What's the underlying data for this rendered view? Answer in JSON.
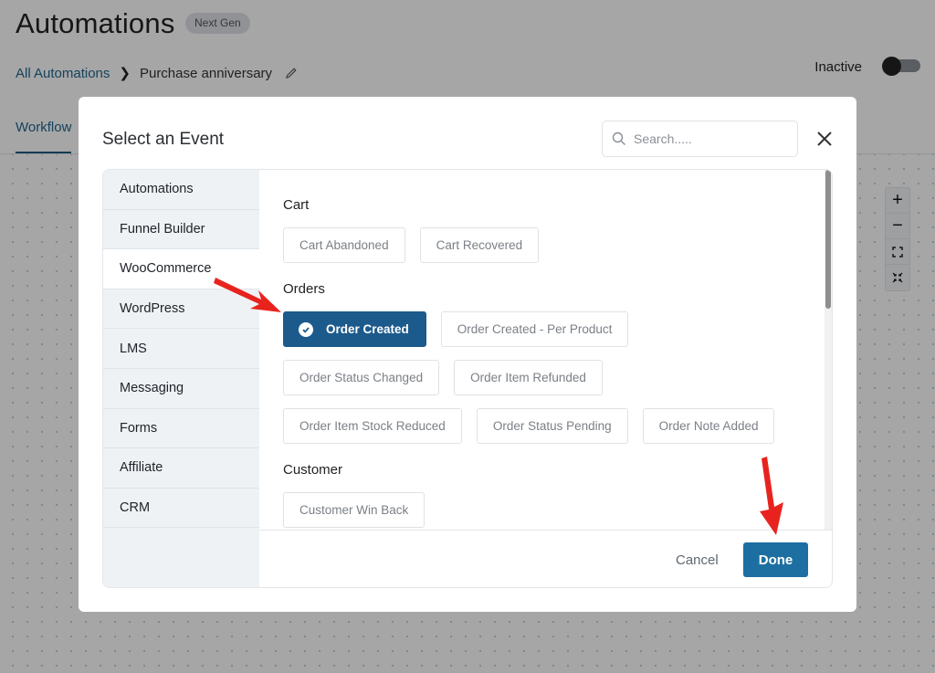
{
  "page": {
    "title": "Automations",
    "badge": "Next Gen",
    "breadcrumb": {
      "parent": "All Automations",
      "current": "Purchase anniversary"
    },
    "status_label": "Inactive",
    "status_toggle_on": false,
    "tabs": [
      {
        "label": "Workflow",
        "active": true
      }
    ],
    "zoom_controls": {
      "zoom_in": "+",
      "zoom_out": "−"
    }
  },
  "modal": {
    "title": "Select an Event",
    "search_placeholder": "Search.....",
    "search_value": "",
    "categories": [
      {
        "label": "Automations",
        "active": false
      },
      {
        "label": "Funnel Builder",
        "active": false
      },
      {
        "label": "WooCommerce",
        "active": true
      },
      {
        "label": "WordPress",
        "active": false
      },
      {
        "label": "LMS",
        "active": false
      },
      {
        "label": "Messaging",
        "active": false
      },
      {
        "label": "Forms",
        "active": false
      },
      {
        "label": "Affiliate",
        "active": false
      },
      {
        "label": "CRM",
        "active": false
      }
    ],
    "groups": [
      {
        "title": "Cart",
        "events": [
          "Cart Abandoned",
          "Cart Recovered"
        ]
      },
      {
        "title": "Orders",
        "events": [
          "Order Created",
          "Order Created - Per Product",
          "Order Status Changed",
          "Order Item Refunded",
          "Order Item Stock Reduced",
          "Order Status Pending",
          "Order Note Added"
        ]
      },
      {
        "title": "Customer",
        "events": [
          "Customer Win Back"
        ]
      }
    ],
    "selected_event": "Order Created",
    "cancel_label": "Cancel",
    "done_label": "Done"
  },
  "colors": {
    "primary": "#1d6fa2",
    "selected": "#1c5a8c",
    "link": "#21678f",
    "annotation_arrow": "#e8231d"
  }
}
